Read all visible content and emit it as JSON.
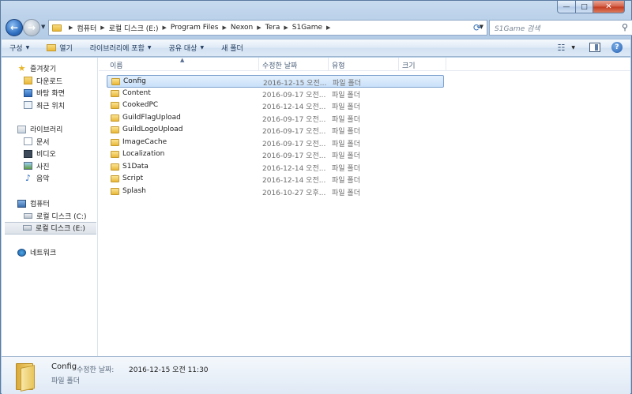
{
  "window": {
    "caption_min": "—",
    "caption_max": "□",
    "caption_close": "✕"
  },
  "address": {
    "breadcrumbs": [
      "컴퓨터",
      "로컬 디스크 (E:)",
      "Program Files",
      "Nexon",
      "Tera",
      "S1Game"
    ],
    "search_placeholder": "S1Game 검색"
  },
  "toolbar": {
    "organize": "구성",
    "open": "열기",
    "include_in_library": "라이브러리에 포함",
    "share_with": "공유 대상",
    "new_folder": "새 폴더"
  },
  "nav": {
    "favorites": {
      "label": "즐겨찾기",
      "items": [
        "다운로드",
        "바탕 화면",
        "최근 위치"
      ]
    },
    "libraries": {
      "label": "라이브러리",
      "items": [
        "문서",
        "비디오",
        "사진",
        "음악"
      ]
    },
    "computer": {
      "label": "컴퓨터",
      "items": [
        "로컬 디스크 (C:)",
        "로컬 디스크 (E:)"
      ],
      "selected": "로컬 디스크 (E:)"
    },
    "network": {
      "label": "네트워크"
    }
  },
  "columns": {
    "name": "이름",
    "modified": "수정한 날짜",
    "type": "유형",
    "size": "크기"
  },
  "files": [
    {
      "name": "Config",
      "modified": "2016-12-15 오전...",
      "type": "파일 폴더",
      "selected": true
    },
    {
      "name": "Content",
      "modified": "2016-09-17 오전...",
      "type": "파일 폴더"
    },
    {
      "name": "CookedPC",
      "modified": "2016-12-14 오전...",
      "type": "파일 폴더"
    },
    {
      "name": "GuildFlagUpload",
      "modified": "2016-09-17 오전...",
      "type": "파일 폴더"
    },
    {
      "name": "GuildLogoUpload",
      "modified": "2016-09-17 오전...",
      "type": "파일 폴더"
    },
    {
      "name": "ImageCache",
      "modified": "2016-09-17 오전...",
      "type": "파일 폴더"
    },
    {
      "name": "Localization",
      "modified": "2016-09-17 오전...",
      "type": "파일 폴더"
    },
    {
      "name": "S1Data",
      "modified": "2016-12-14 오전...",
      "type": "파일 폴더"
    },
    {
      "name": "Script",
      "modified": "2016-12-14 오전...",
      "type": "파일 폴더"
    },
    {
      "name": "Splash",
      "modified": "2016-10-27 오후...",
      "type": "파일 폴더"
    }
  ],
  "details": {
    "name": "Config",
    "modified_label": "수정한 날짜:",
    "modified_value": "2016-12-15 오전 11:30",
    "type": "파일 폴더"
  },
  "colors": {
    "accent": "#2f6fc1",
    "selection": "#c9e0f9",
    "folder": "#e9b83a"
  },
  "icons": {
    "back": "back-arrow-icon",
    "forward": "forward-arrow-icon",
    "refresh": "refresh-icon",
    "search": "search-icon",
    "views": "views-icon",
    "preview_pane": "preview-pane-icon",
    "help": "help-icon"
  }
}
